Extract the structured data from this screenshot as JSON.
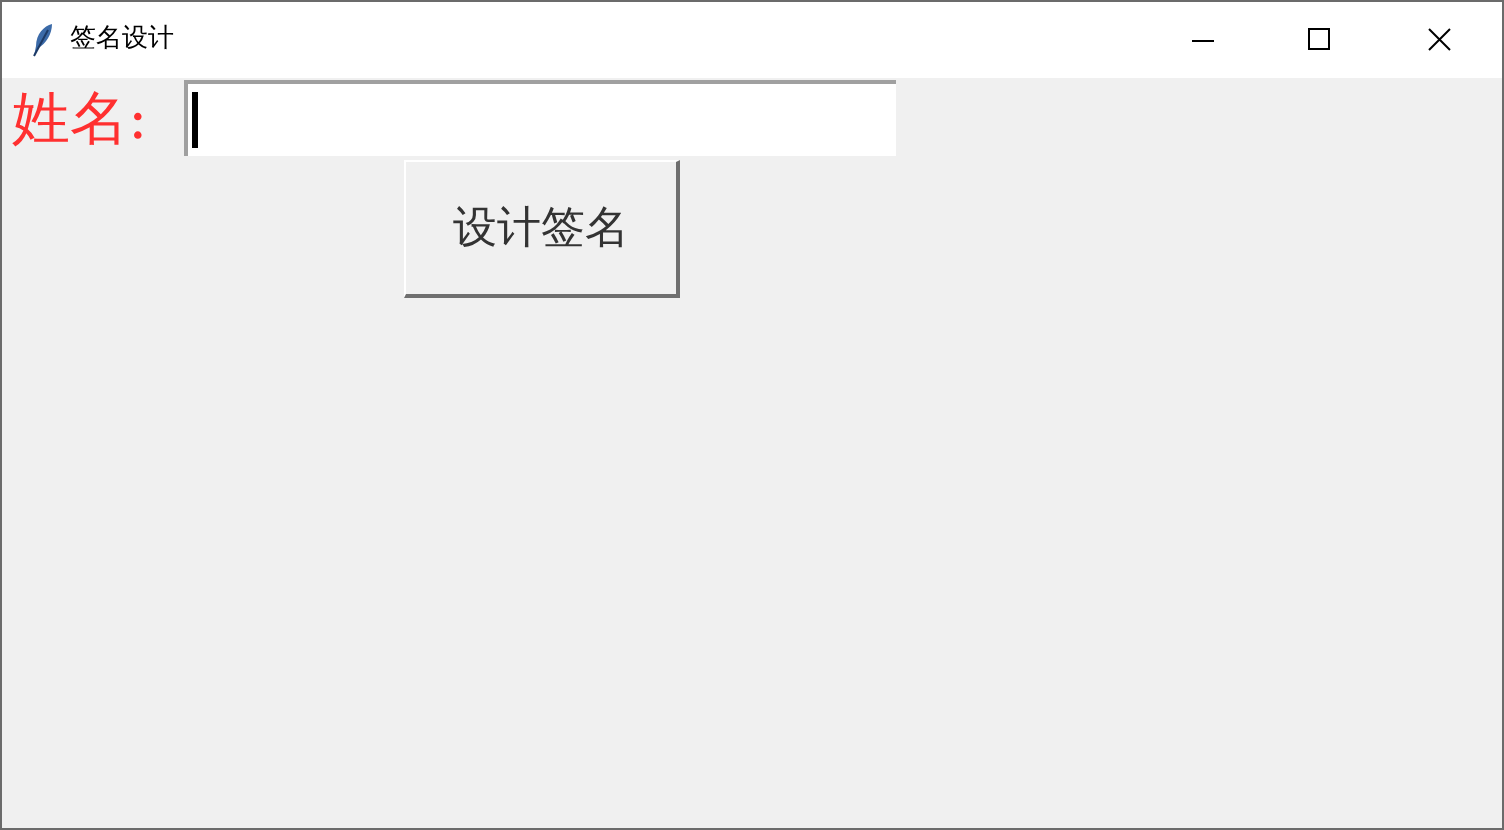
{
  "window": {
    "title": "签名设计"
  },
  "name_label": "姓名:",
  "name_field": {
    "focused": true
  },
  "buttons": [
    "设计签名"
  ]
}
